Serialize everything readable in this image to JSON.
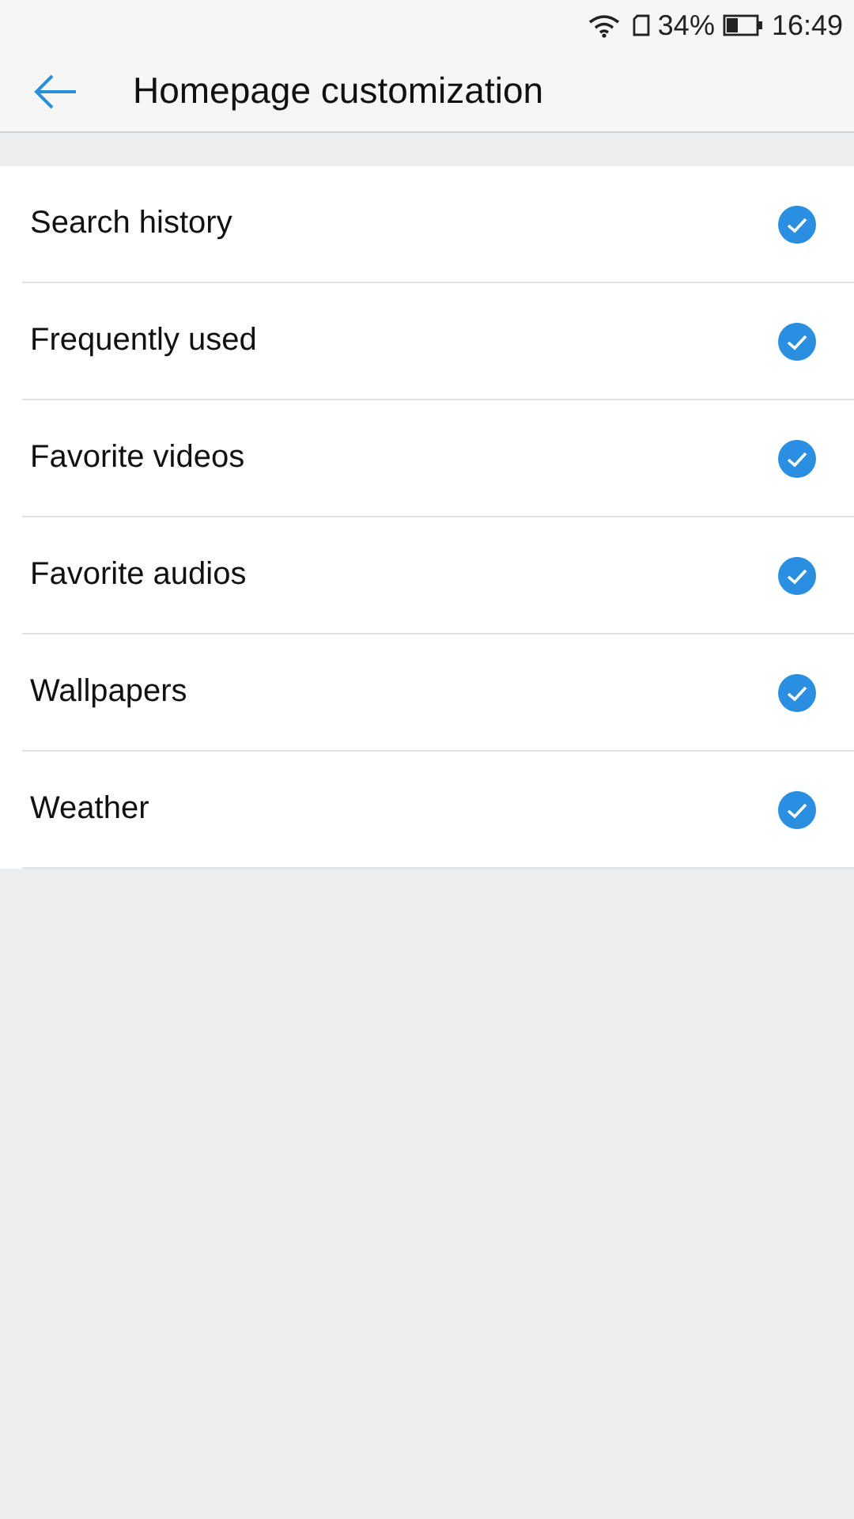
{
  "status_bar": {
    "battery_percent": "34%",
    "time": "16:49"
  },
  "header": {
    "title": "Homepage customization"
  },
  "items": [
    {
      "label": "Search history",
      "checked": true
    },
    {
      "label": "Frequently used",
      "checked": true
    },
    {
      "label": "Favorite videos",
      "checked": true
    },
    {
      "label": "Favorite audios",
      "checked": true
    },
    {
      "label": "Wallpapers",
      "checked": true
    },
    {
      "label": "Weather",
      "checked": true
    }
  ]
}
